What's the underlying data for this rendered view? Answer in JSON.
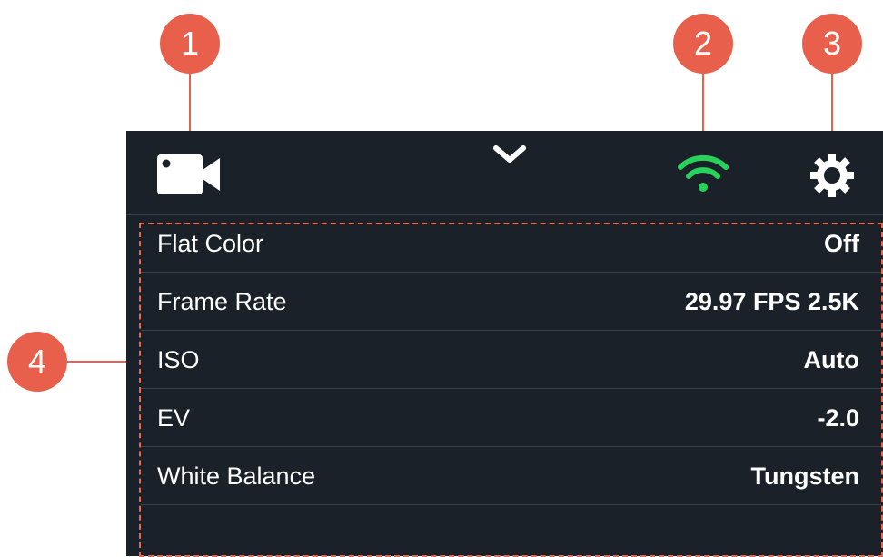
{
  "colors": {
    "callout": "#e8604c",
    "panel_bg": "#1b2129",
    "wifi": "#27d15a",
    "highlight_border": "#e06a55",
    "text": "#ffffff"
  },
  "callouts": [
    "1",
    "2",
    "3",
    "4"
  ],
  "topbar": {
    "mode_icon": "video-camera-icon",
    "chevron_icon": "chevron-down-icon",
    "wifi_icon": "wifi-icon",
    "settings_icon": "gear-icon"
  },
  "settings": [
    {
      "label": "Flat Color",
      "value": "Off"
    },
    {
      "label": "Frame Rate",
      "value": "29.97 FPS 2.5K"
    },
    {
      "label": "ISO",
      "value": "Auto"
    },
    {
      "label": "EV",
      "value": "-2.0"
    },
    {
      "label": "White Balance",
      "value": "Tungsten"
    }
  ]
}
